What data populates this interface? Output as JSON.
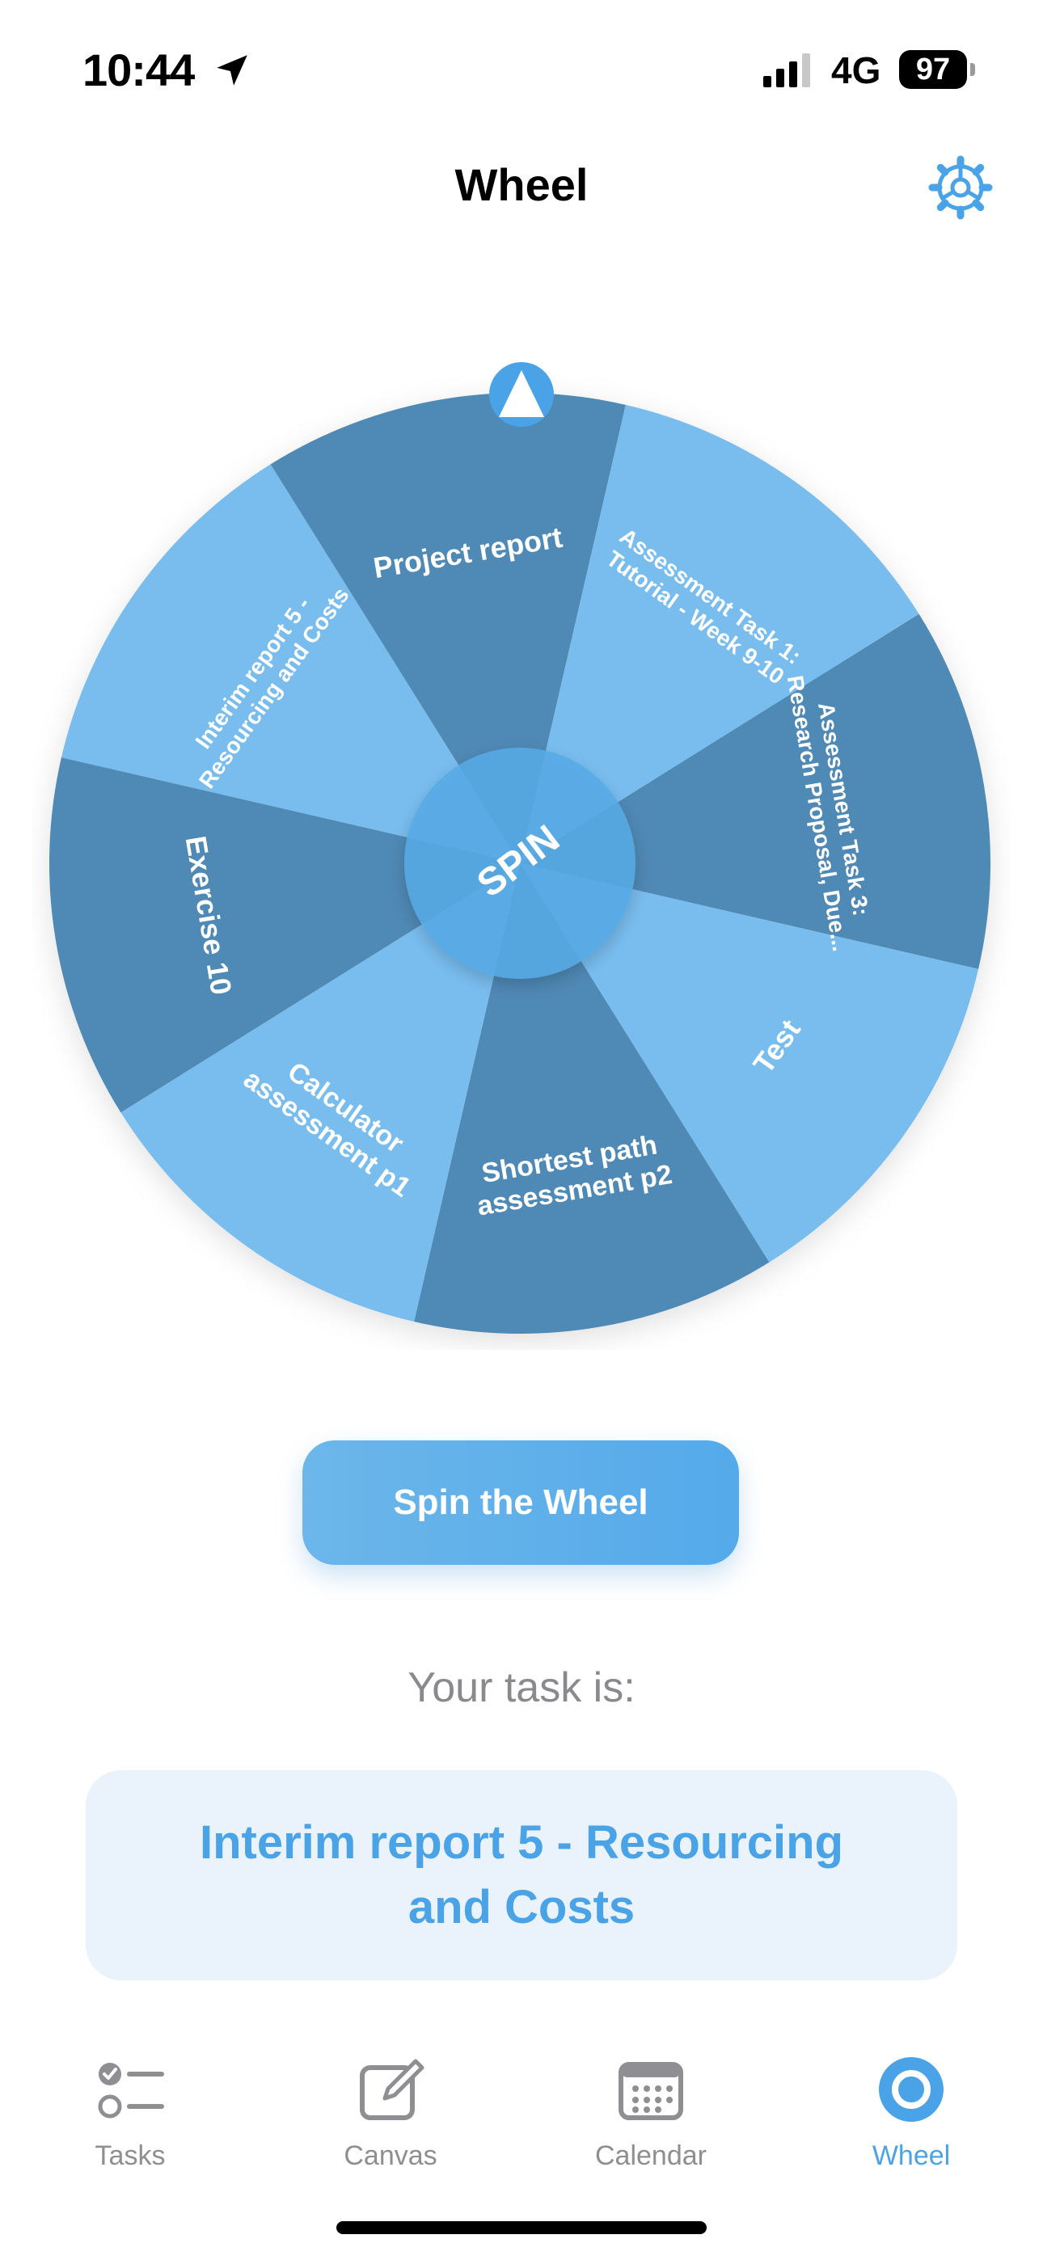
{
  "status_bar": {
    "time": "10:44",
    "network": "4G",
    "battery": "97"
  },
  "nav": {
    "title": "Wheel",
    "settings_icon": "gear-icon"
  },
  "wheel": {
    "center_label": "SPIN",
    "colors": {
      "light": "#79bdef",
      "dark": "#5089b5",
      "hub": "#56aae6",
      "text": "#ffffff"
    },
    "segments": [
      {
        "lines": [
          "Interim report 5 -",
          "Resourcing and Costs"
        ],
        "shade": "light"
      },
      {
        "lines": [
          "Project report"
        ],
        "shade": "dark"
      },
      {
        "lines": [
          "Assessment Task 1:",
          "Tutorial - Week 9-10"
        ],
        "shade": "light"
      },
      {
        "lines": [
          "Assessment Task 3:",
          "Research Proposal, Due..."
        ],
        "shade": "dark"
      },
      {
        "lines": [
          "Test"
        ],
        "shade": "light"
      },
      {
        "lines": [
          "Shortest path",
          "assessment p2"
        ],
        "shade": "dark"
      },
      {
        "lines": [
          "Calculator",
          "assessment p1"
        ],
        "shade": "light"
      },
      {
        "lines": [
          "Exercise 10"
        ],
        "shade": "dark"
      }
    ]
  },
  "spin_button": {
    "label": "Spin the Wheel"
  },
  "result": {
    "prompt": "Your task is:",
    "task": "Interim report 5 - Resourcing and Costs"
  },
  "tabs": [
    {
      "label": "Tasks",
      "icon": "checklist-icon",
      "active": false
    },
    {
      "label": "Canvas",
      "icon": "edit-icon",
      "active": false
    },
    {
      "label": "Calendar",
      "icon": "calendar-icon",
      "active": false
    },
    {
      "label": "Wheel",
      "icon": "wheel-circle-icon",
      "active": true
    }
  ]
}
